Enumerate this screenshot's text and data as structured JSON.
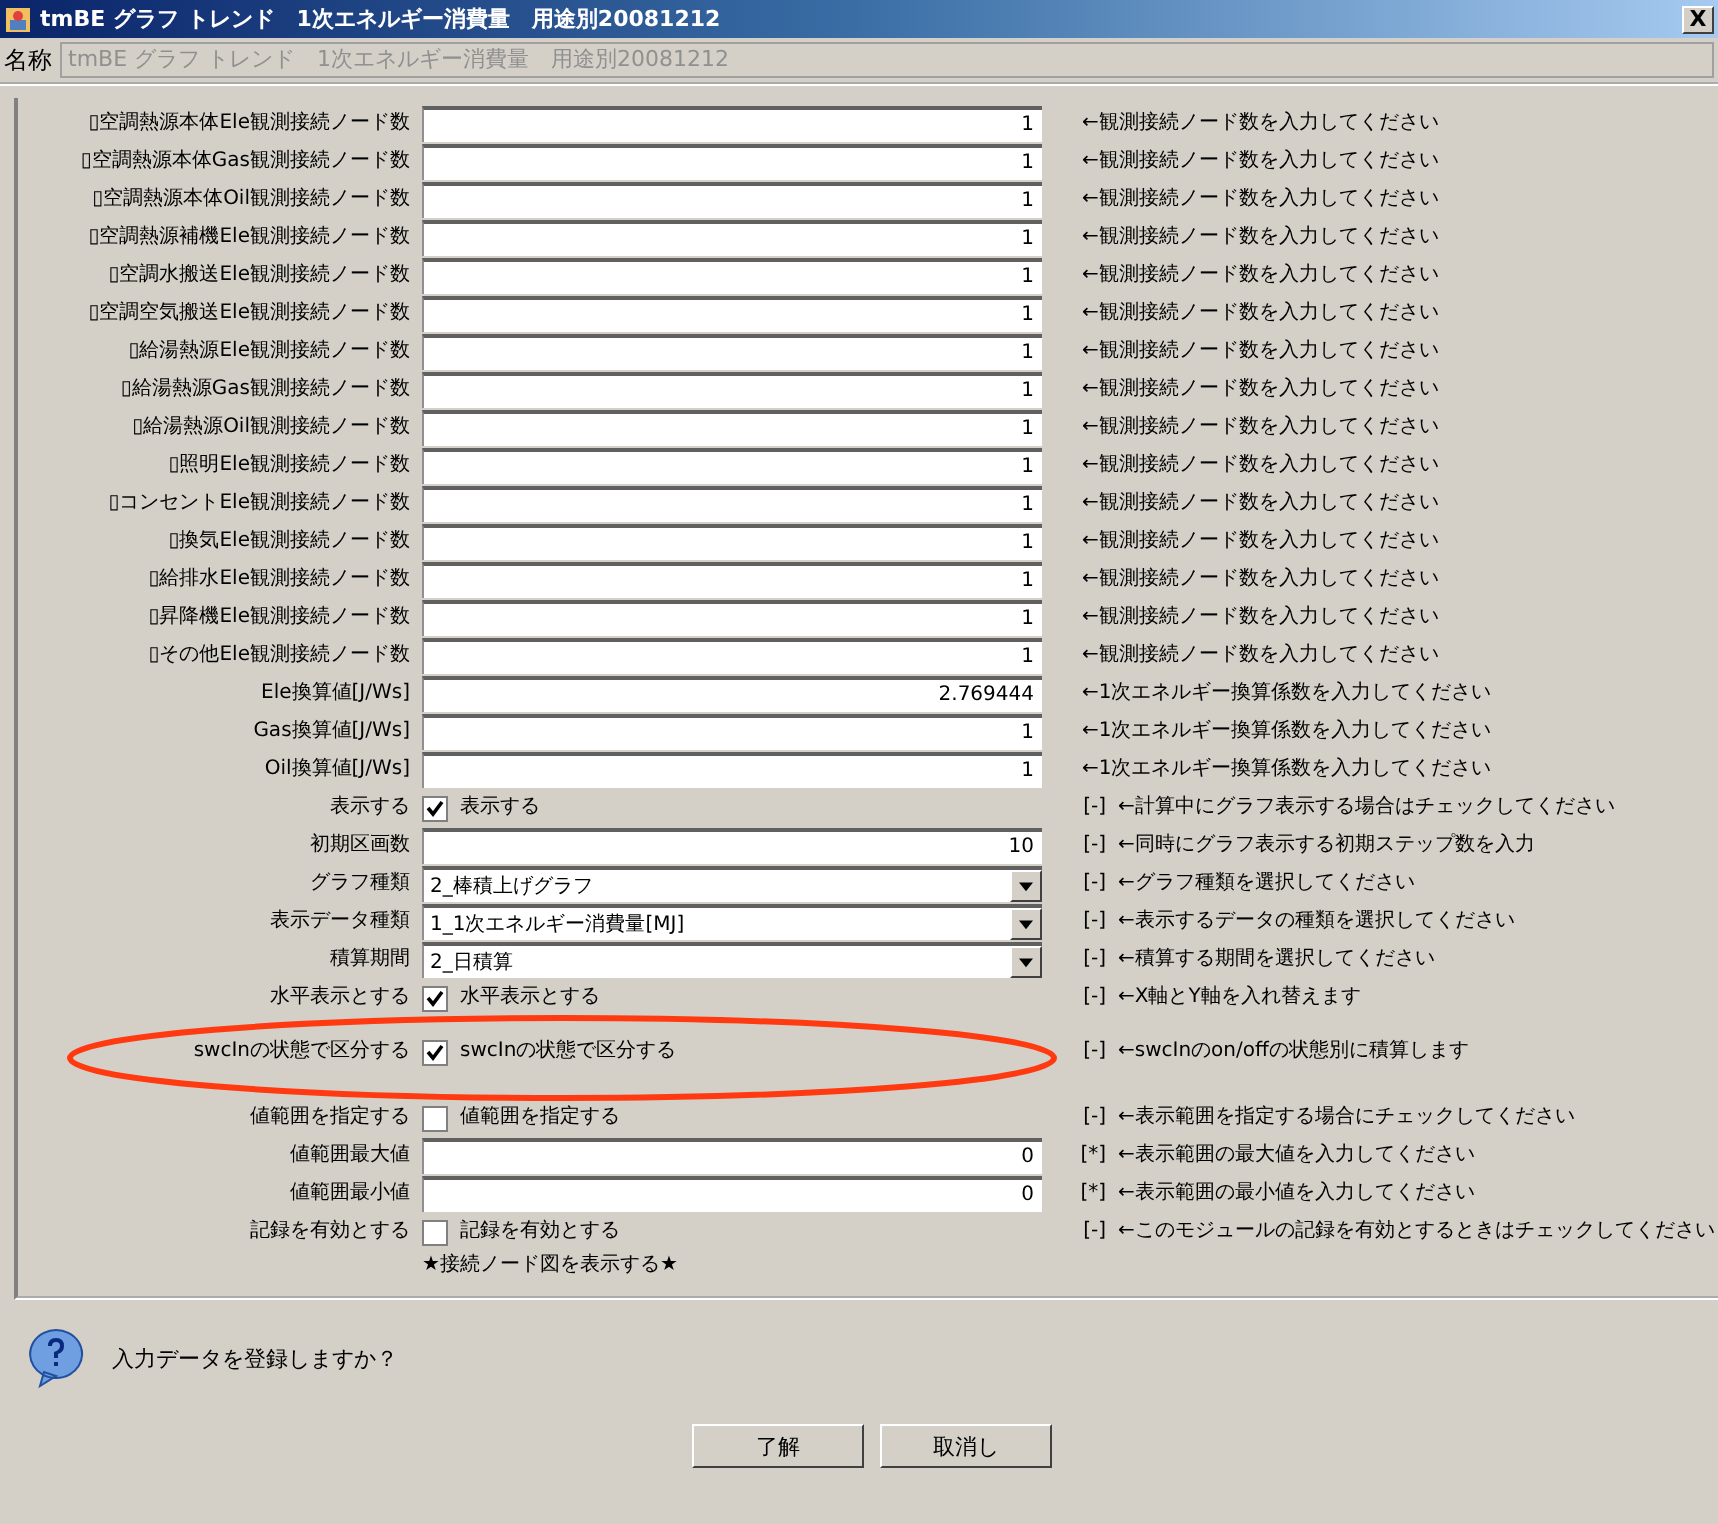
{
  "window": {
    "title": "tmBE グラフ トレンド　1次エネルギー消費量　用途別20081212",
    "close": "X"
  },
  "name_row": {
    "label": "名称",
    "value": "tmBE グラフ トレンド　1次エネルギー消費量　用途別20081212"
  },
  "rows": [
    {
      "kind": "number",
      "label": "▯空調熱源本体Ele観測接続ノード数",
      "value": "1",
      "hint": "←観測接続ノード数を入力してください"
    },
    {
      "kind": "number",
      "label": "▯空調熱源本体Gas観測接続ノード数",
      "value": "1",
      "hint": "←観測接続ノード数を入力してください"
    },
    {
      "kind": "number",
      "label": "▯空調熱源本体Oil観測接続ノード数",
      "value": "1",
      "hint": "←観測接続ノード数を入力してください"
    },
    {
      "kind": "number",
      "label": "▯空調熱源補機Ele観測接続ノード数",
      "value": "1",
      "hint": "←観測接続ノード数を入力してください"
    },
    {
      "kind": "number",
      "label": "▯空調水搬送Ele観測接続ノード数",
      "value": "1",
      "hint": "←観測接続ノード数を入力してください"
    },
    {
      "kind": "number",
      "label": "▯空調空気搬送Ele観測接続ノード数",
      "value": "1",
      "hint": "←観測接続ノード数を入力してください"
    },
    {
      "kind": "number",
      "label": "▯給湯熱源Ele観測接続ノード数",
      "value": "1",
      "hint": "←観測接続ノード数を入力してください"
    },
    {
      "kind": "number",
      "label": "▯給湯熱源Gas観測接続ノード数",
      "value": "1",
      "hint": "←観測接続ノード数を入力してください"
    },
    {
      "kind": "number",
      "label": "▯給湯熱源Oil観測接続ノード数",
      "value": "1",
      "hint": "←観測接続ノード数を入力してください"
    },
    {
      "kind": "number",
      "label": "▯照明Ele観測接続ノード数",
      "value": "1",
      "hint": "←観測接続ノード数を入力してください"
    },
    {
      "kind": "number",
      "label": "▯コンセントEle観測接続ノード数",
      "value": "1",
      "hint": "←観測接続ノード数を入力してください"
    },
    {
      "kind": "number",
      "label": "▯換気Ele観測接続ノード数",
      "value": "1",
      "hint": "←観測接続ノード数を入力してください"
    },
    {
      "kind": "number",
      "label": "▯給排水Ele観測接続ノード数",
      "value": "1",
      "hint": "←観測接続ノード数を入力してください"
    },
    {
      "kind": "number",
      "label": "▯昇降機Ele観測接続ノード数",
      "value": "1",
      "hint": "←観測接続ノード数を入力してください"
    },
    {
      "kind": "number",
      "label": "▯その他Ele観測接続ノード数",
      "value": "1",
      "hint": "←観測接続ノード数を入力してください"
    },
    {
      "kind": "number",
      "label": "Ele換算値[J/Ws]",
      "value": "2.769444",
      "hint": "←1次エネルギー換算係数を入力してください"
    },
    {
      "kind": "number",
      "label": "Gas換算値[J/Ws]",
      "value": "1",
      "hint": "←1次エネルギー換算係数を入力してください"
    },
    {
      "kind": "number",
      "label": "Oil換算値[J/Ws]",
      "value": "1",
      "hint": "←1次エネルギー換算係数を入力してください"
    },
    {
      "kind": "checkbox",
      "label": "表示する",
      "checked": true,
      "option": "表示する",
      "flag": "[-]",
      "hint": "←計算中にグラフ表示する場合はチェックしてください"
    },
    {
      "kind": "number",
      "label": "初期区画数",
      "value": "10",
      "flag": "[-]",
      "hint": "←同時にグラフ表示する初期ステップ数を入力"
    },
    {
      "kind": "select",
      "label": "グラフ種類",
      "value": "2_棒積上げグラフ",
      "flag": "[-]",
      "hint": "←グラフ種類を選択してください"
    },
    {
      "kind": "select",
      "label": "表示データ種類",
      "value": "1_1次エネルギー消費量[MJ]",
      "flag": "[-]",
      "hint": "←表示するデータの種類を選択してください"
    },
    {
      "kind": "select",
      "label": "積算期間",
      "value": "2_日積算",
      "flag": "[-]",
      "hint": "←積算する期間を選択してください"
    },
    {
      "kind": "checkbox",
      "label": "水平表示とする",
      "checked": true,
      "option": "水平表示とする",
      "flag": "[-]",
      "hint": "←X軸とY軸を入れ替えます"
    },
    {
      "kind": "checkbox",
      "label": "swcInの状態で区分する",
      "checked": true,
      "option": "swcInの状態で区分する",
      "flag": "[-]",
      "hint": "←swcInのon/offの状態別に積算します",
      "highlighted": true
    },
    {
      "kind": "checkbox",
      "label": "値範囲を指定する",
      "checked": false,
      "option": "値範囲を指定する",
      "flag": "[-]",
      "hint": "←表示範囲を指定する場合にチェックしてください"
    },
    {
      "kind": "number",
      "label": "値範囲最大値",
      "value": "0",
      "flag": "[*]",
      "hint": "←表示範囲の最大値を入力してください"
    },
    {
      "kind": "number",
      "label": "値範囲最小値",
      "value": "0",
      "flag": "[*]",
      "hint": "←表示範囲の最小値を入力してください"
    },
    {
      "kind": "checkbox",
      "label": "記録を有効とする",
      "checked": false,
      "option": "記録を有効とする",
      "flag": "[-]",
      "hint": "←このモジュールの記録を有効とするときはチェックしてください"
    },
    {
      "kind": "note",
      "text": "★接続ノード図を表示する★"
    }
  ],
  "dialog": {
    "message": "入力データを登録しますか？",
    "buttons": [
      "了解",
      "取消し"
    ]
  }
}
